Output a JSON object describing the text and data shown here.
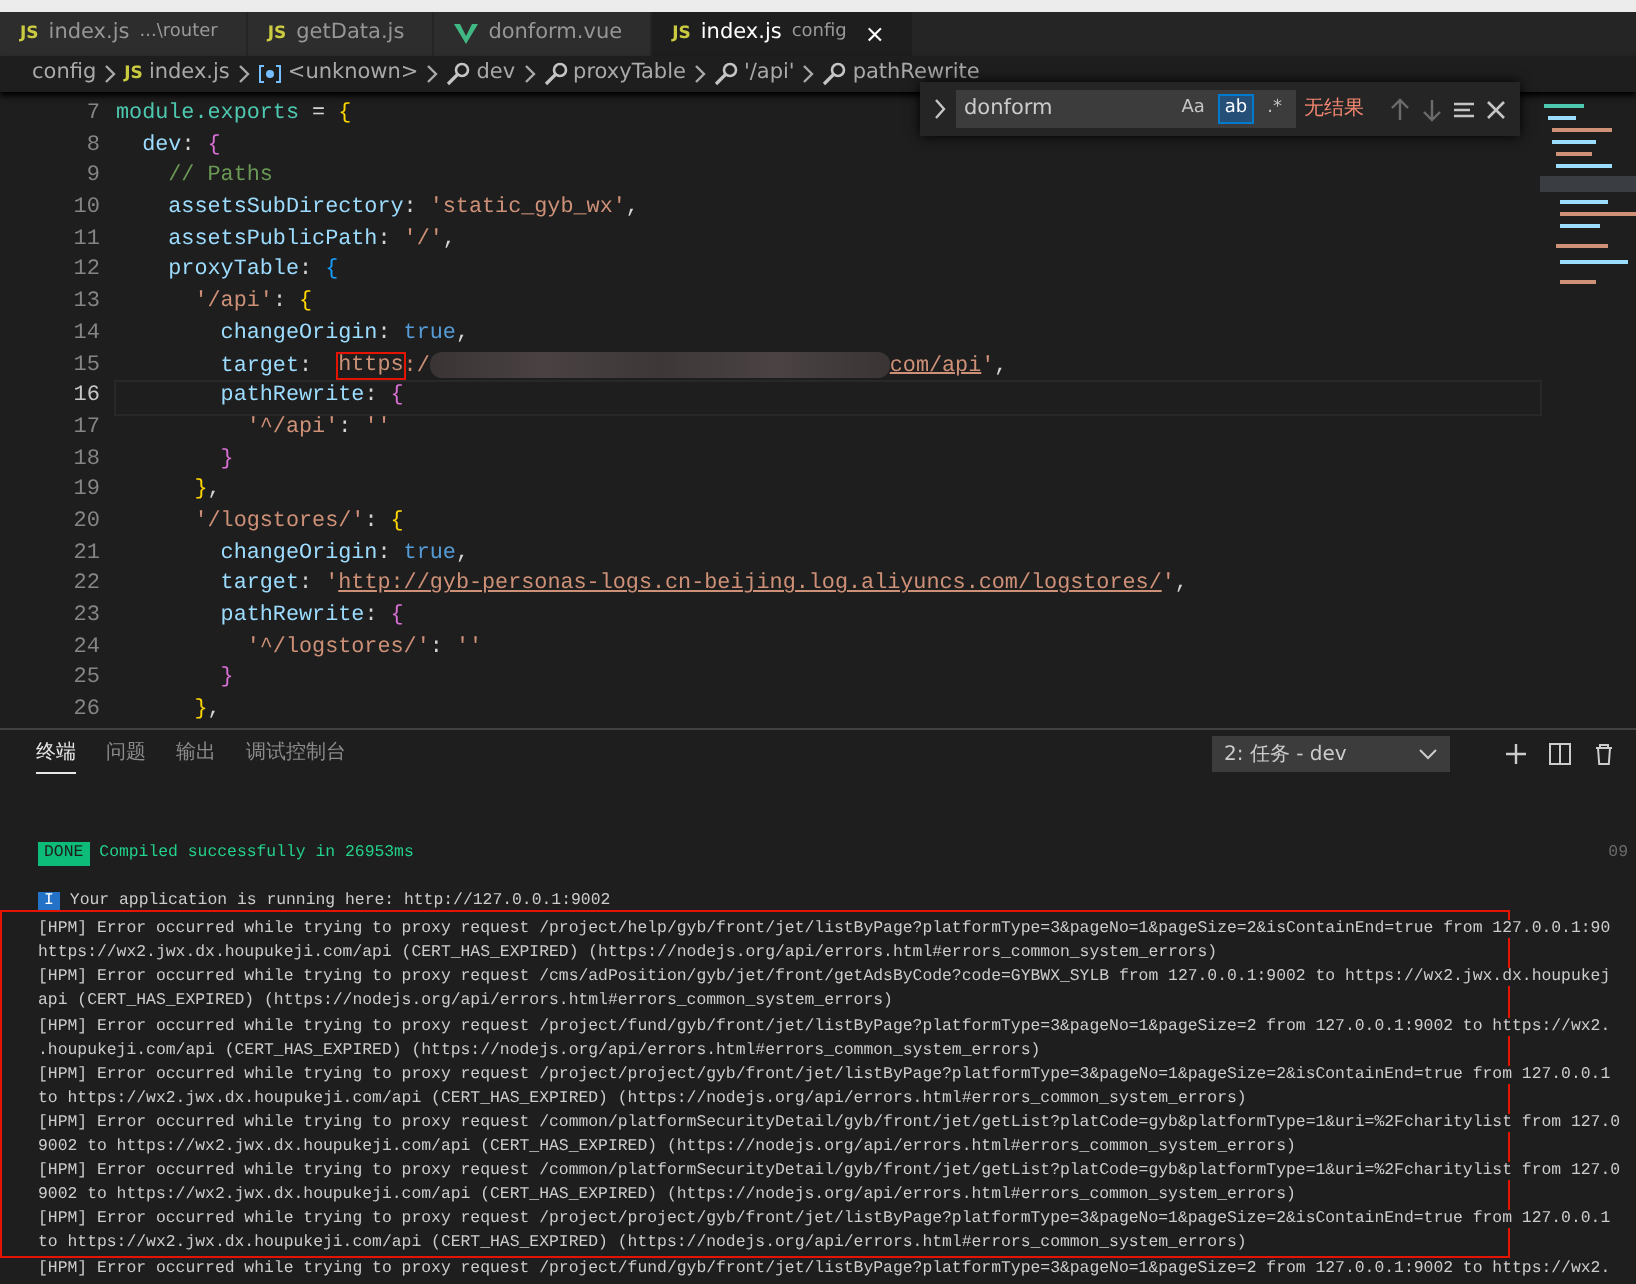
{
  "tabs": [
    {
      "kind": "js",
      "badge": "JS",
      "label": "index.js",
      "description": "...\\router",
      "selected": false
    },
    {
      "kind": "js",
      "badge": "JS",
      "label": "getData.js",
      "selected": false
    },
    {
      "kind": "vue",
      "label": "donform.vue",
      "selected": false
    },
    {
      "kind": "js",
      "badge": "JS",
      "label": "index.js",
      "description": "config",
      "selected": true,
      "close": "×"
    }
  ],
  "breadcrumb": [
    {
      "kind": "folder",
      "label": "config"
    },
    {
      "kind": "js",
      "badge": "JS",
      "label": "index.js"
    },
    {
      "kind": "variable",
      "label": "<unknown>"
    },
    {
      "kind": "property",
      "label": "dev"
    },
    {
      "kind": "property",
      "label": "proxyTable"
    },
    {
      "kind": "property",
      "label": "'/api'"
    },
    {
      "kind": "property",
      "label": "pathRewrite"
    }
  ],
  "find": {
    "value": "donform",
    "toggles": [
      {
        "label": "Aa",
        "on": false
      },
      {
        "label": "ab",
        "on": true
      },
      {
        "label": ".*",
        "on": false
      }
    ],
    "result": "无结果"
  },
  "code": [
    {
      "number": "7",
      "current": false,
      "tokens": [
        {
          "kind": "module",
          "text": "module.exports"
        },
        {
          "kind": "punct",
          "text": " = "
        },
        {
          "kind": "brace1",
          "text": "{"
        }
      ]
    },
    {
      "number": "8",
      "current": false,
      "tokens": [
        {
          "kind": "prop",
          "text": "  dev"
        },
        {
          "kind": "punct",
          "text": ": "
        },
        {
          "kind": "brace2",
          "text": "{"
        }
      ]
    },
    {
      "number": "9",
      "current": false,
      "tokens": [
        {
          "kind": "comment",
          "text": "    // Paths"
        }
      ]
    },
    {
      "number": "10",
      "current": false,
      "tokens": [
        {
          "kind": "prop",
          "text": "    assetsSubDirectory"
        },
        {
          "kind": "punct",
          "text": ": "
        },
        {
          "kind": "string",
          "text": "'static_gyb_wx'"
        },
        {
          "kind": "punct",
          "text": ","
        }
      ]
    },
    {
      "number": "11",
      "current": false,
      "tokens": [
        {
          "kind": "prop",
          "text": "    assetsPublicPath"
        },
        {
          "kind": "punct",
          "text": ": "
        },
        {
          "kind": "string",
          "text": "'/'"
        },
        {
          "kind": "punct",
          "text": ","
        }
      ]
    },
    {
      "number": "12",
      "current": false,
      "tokens": [
        {
          "kind": "prop",
          "text": "    proxyTable"
        },
        {
          "kind": "punct",
          "text": ": "
        },
        {
          "kind": "brace3",
          "text": "{"
        }
      ]
    },
    {
      "number": "13",
      "current": false,
      "tokens": [
        {
          "kind": "string",
          "text": "      '/api'"
        },
        {
          "kind": "punct",
          "text": ": "
        },
        {
          "kind": "brace1",
          "text": "{"
        }
      ]
    },
    {
      "number": "14",
      "current": false,
      "tokens": [
        {
          "kind": "prop",
          "text": "        changeOrigin"
        },
        {
          "kind": "punct",
          "text": ": "
        },
        {
          "kind": "bool",
          "text": "true"
        },
        {
          "kind": "punct",
          "text": ","
        }
      ]
    },
    {
      "number": "15",
      "current": false,
      "tokens": [
        {
          "kind": "prop",
          "text": "        target"
        },
        {
          "kind": "punct",
          "text": ":  "
        },
        {
          "kind": "boxed",
          "text": "https"
        },
        {
          "kind": "string",
          "text": ":/"
        },
        {
          "kind": "blur"
        },
        {
          "kind": "link",
          "text": "com/api"
        },
        {
          "kind": "string",
          "text": "'"
        },
        {
          "kind": "punct",
          "text": ","
        }
      ]
    },
    {
      "number": "16",
      "current": true,
      "tokens": [
        {
          "kind": "prop",
          "text": "        pathRewrite"
        },
        {
          "kind": "punct",
          "text": ": "
        },
        {
          "kind": "brace2",
          "text": "{"
        }
      ]
    },
    {
      "number": "17",
      "current": false,
      "tokens": [
        {
          "kind": "string",
          "text": "          '^/api'"
        },
        {
          "kind": "punct",
          "text": ": "
        },
        {
          "kind": "string",
          "text": "''"
        }
      ]
    },
    {
      "number": "18",
      "current": false,
      "tokens": [
        {
          "kind": "brace2",
          "text": "        }"
        }
      ]
    },
    {
      "number": "19",
      "current": false,
      "tokens": [
        {
          "kind": "brace1",
          "text": "      }"
        },
        {
          "kind": "punct",
          "text": ","
        }
      ]
    },
    {
      "number": "20",
      "current": false,
      "tokens": [
        {
          "kind": "string",
          "text": "      '/logstores/'"
        },
        {
          "kind": "punct",
          "text": ": "
        },
        {
          "kind": "brace1",
          "text": "{"
        }
      ]
    },
    {
      "number": "21",
      "current": false,
      "tokens": [
        {
          "kind": "prop",
          "text": "        changeOrigin"
        },
        {
          "kind": "punct",
          "text": ": "
        },
        {
          "kind": "bool",
          "text": "true"
        },
        {
          "kind": "punct",
          "text": ","
        }
      ]
    },
    {
      "number": "22",
      "current": false,
      "tokens": [
        {
          "kind": "prop",
          "text": "        target"
        },
        {
          "kind": "punct",
          "text": ": "
        },
        {
          "kind": "string",
          "text": "'"
        },
        {
          "kind": "link",
          "text": "http://gyb-personas-logs.cn-beijing.log.aliyuncs.com/logstores/"
        },
        {
          "kind": "string",
          "text": "'"
        },
        {
          "kind": "punct",
          "text": ","
        }
      ]
    },
    {
      "number": "23",
      "current": false,
      "tokens": [
        {
          "kind": "prop",
          "text": "        pathRewrite"
        },
        {
          "kind": "punct",
          "text": ": "
        },
        {
          "kind": "brace2",
          "text": "{"
        }
      ]
    },
    {
      "number": "24",
      "current": false,
      "tokens": [
        {
          "kind": "string",
          "text": "          '^/logstores/'"
        },
        {
          "kind": "punct",
          "text": ": "
        },
        {
          "kind": "string",
          "text": "''"
        }
      ]
    },
    {
      "number": "25",
      "current": false,
      "tokens": [
        {
          "kind": "brace2",
          "text": "        }"
        }
      ]
    },
    {
      "number": "26",
      "current": false,
      "tokens": [
        {
          "kind": "brace1",
          "text": "      }"
        },
        {
          "kind": "punct",
          "text": ","
        }
      ]
    }
  ],
  "panel": {
    "tabs": [
      {
        "label": "终端",
        "selected": true
      },
      {
        "label": "问题",
        "selected": false
      },
      {
        "label": "输出",
        "selected": false
      },
      {
        "label": "调试控制台",
        "selected": false
      }
    ],
    "dropdown": "2: 任务 - dev"
  },
  "terminal": {
    "done": {
      "badge": "DONE",
      "text": "Compiled successfully in 26953ms",
      "time": "09"
    },
    "info": {
      "badge": "I",
      "text": "Your application is running here: http://127.0.0.1:9002"
    },
    "lines": [
      "[HPM] Error occurred while trying to proxy request /project/help/gyb/front/jet/listByPage?platformType=3&pageNo=1&pageSize=2&isContainEnd=true from 127.0.0.1:90",
      "https://wx2.jwx.dx.houpukeji.com/api (CERT_HAS_EXPIRED) (https://nodejs.org/api/errors.html#errors_common_system_errors)",
      "[HPM] Error occurred while trying to proxy request /cms/adPosition/gyb/jet/front/getAdsByCode?code=GYBWX_SYLB from 127.0.0.1:9002 to https://wx2.jwx.dx.houpukej",
      "api (CERT_HAS_EXPIRED) (https://nodejs.org/api/errors.html#errors_common_system_errors)",
      "[HPM] Error occurred while trying to proxy request /project/fund/gyb/front/jet/listByPage?platformType=3&pageNo=1&pageSize=2 from 127.0.0.1:9002 to https://wx2.",
      ".houpukeji.com/api (CERT_HAS_EXPIRED) (https://nodejs.org/api/errors.html#errors_common_system_errors)",
      "[HPM] Error occurred while trying to proxy request /project/project/gyb/front/jet/listByPage?platformType=3&pageNo=1&pageSize=2&isContainEnd=true from 127.0.0.1",
      "to https://wx2.jwx.dx.houpukeji.com/api (CERT_HAS_EXPIRED) (https://nodejs.org/api/errors.html#errors_common_system_errors)",
      "[HPM] Error occurred while trying to proxy request /common/platformSecurityDetail/gyb/front/jet/getList?platCode=gyb&platformType=1&uri=%2Fcharitylist from 127.0",
      "9002 to https://wx2.jwx.dx.houpukeji.com/api (CERT_HAS_EXPIRED) (https://nodejs.org/api/errors.html#errors_common_system_errors)",
      "[HPM] Error occurred while trying to proxy request /common/platformSecurityDetail/gyb/front/jet/getList?platCode=gyb&platformType=1&uri=%2Fcharitylist from 127.0",
      "9002 to https://wx2.jwx.dx.houpukeji.com/api (CERT_HAS_EXPIRED) (https://nodejs.org/api/errors.html#errors_common_system_errors)",
      "[HPM] Error occurred while trying to proxy request /project/project/gyb/front/jet/listByPage?platformType=3&pageNo=1&pageSize=2&isContainEnd=true from 127.0.0.1",
      "to https://wx2.jwx.dx.houpukeji.com/api (CERT_HAS_EXPIRED) (https://nodejs.org/api/errors.html#errors_common_system_errors)",
      "[HPM] Error occurred while trying to proxy request /project/fund/gyb/front/jet/listByPage?platformType=3&pageNo=1&pageSize=2 from 127.0.0.1:9002 to https://wx2."
    ]
  }
}
